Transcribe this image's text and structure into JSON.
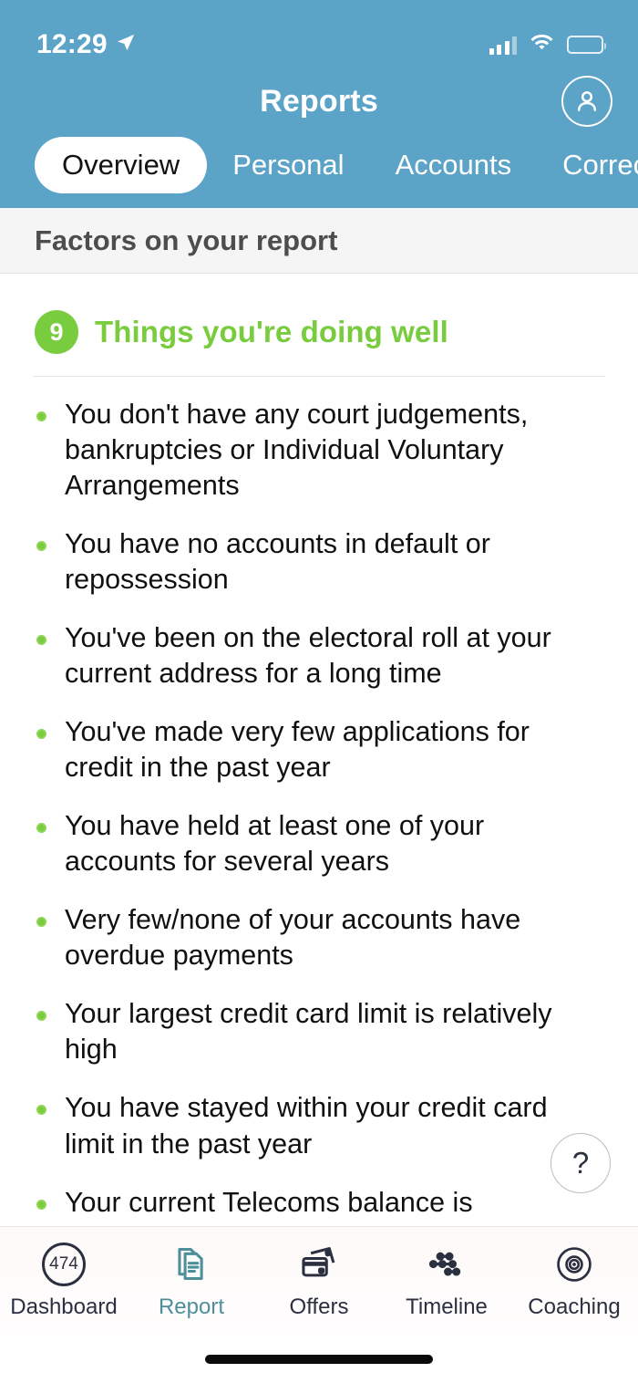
{
  "status_bar": {
    "time": "12:29",
    "location_icon": "location-arrow-icon",
    "signal_icon": "cellular-signal-icon",
    "wifi_icon": "wifi-icon",
    "battery_icon": "battery-icon"
  },
  "header": {
    "title": "Reports",
    "profile_icon": "profile-avatar-icon",
    "background_color": "#5ca3c8",
    "tabs": [
      {
        "label": "Overview",
        "active": true
      },
      {
        "label": "Personal",
        "active": false
      },
      {
        "label": "Accounts",
        "active": false
      },
      {
        "label": "Corrections",
        "active": false
      }
    ]
  },
  "subheader": {
    "title": "Factors on your report"
  },
  "section": {
    "count": "9",
    "title": "Things you're doing well",
    "accent_color": "#78cc3d",
    "items": [
      "You don't have any court judgements, bankruptcies or Individual Voluntary Arrangements",
      "You have no accounts in default or repossession",
      "You've been on the electoral roll at your current address for a long time",
      "You've made very few applications for credit in the past year",
      "You have held at least one of your accounts for several years",
      "Very few/none of your accounts have overdue payments",
      "Your largest credit card limit is relatively high",
      "You have stayed within your credit card limit in the past year",
      "Your current Telecoms balance is relatively low"
    ]
  },
  "help_button": {
    "label": "?"
  },
  "bottom_nav": {
    "active_color": "#4d909a",
    "items": [
      {
        "label": "Dashboard",
        "icon": "credit-score-ring-icon",
        "value": "474",
        "active": false
      },
      {
        "label": "Report",
        "icon": "documents-icon",
        "value": "",
        "active": true
      },
      {
        "label": "Offers",
        "icon": "credit-cards-icon",
        "value": "",
        "active": false
      },
      {
        "label": "Timeline",
        "icon": "timeline-sliders-icon",
        "value": "",
        "active": false
      },
      {
        "label": "Coaching",
        "icon": "target-bullseye-icon",
        "value": "",
        "active": false
      }
    ]
  }
}
